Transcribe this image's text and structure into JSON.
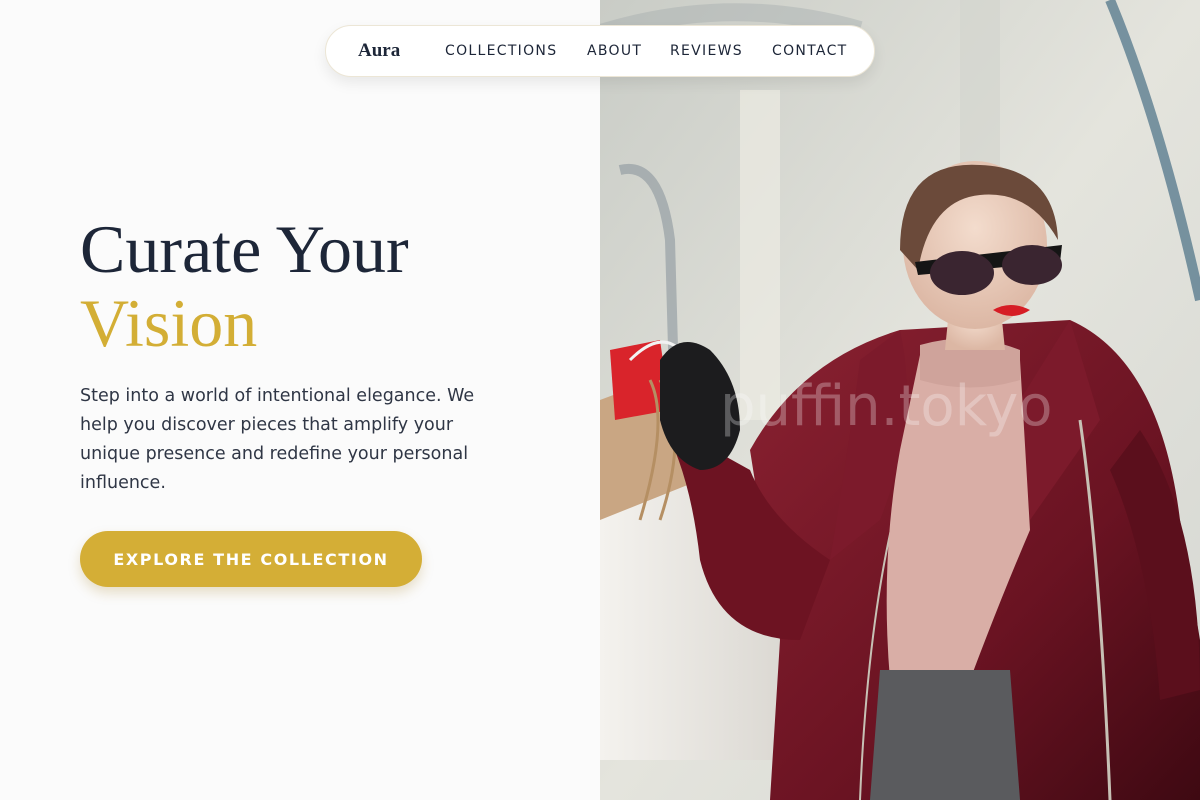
{
  "brand": {
    "name": "Aura"
  },
  "nav": {
    "items": [
      {
        "label": "COLLECTIONS"
      },
      {
        "label": "ABOUT"
      },
      {
        "label": "REVIEWS"
      },
      {
        "label": "CONTACT"
      }
    ]
  },
  "hero": {
    "headline_line1": "Curate Your",
    "headline_line2": "Vision",
    "lead": "Step into a world of intentional elegance. We help you discover pieces that amplify your unique presence and redefine your personal influence.",
    "cta_label": "EXPLORE THE COLLECTION",
    "image": {
      "subject": "woman in burgundy coat and sunglasses holding shopping bags",
      "watermark": "puffin.tokyo"
    }
  },
  "colors": {
    "navy": "#1d2638",
    "gold": "#d4ae36",
    "background": "#fbfbfb",
    "coat": "#6e1524"
  }
}
